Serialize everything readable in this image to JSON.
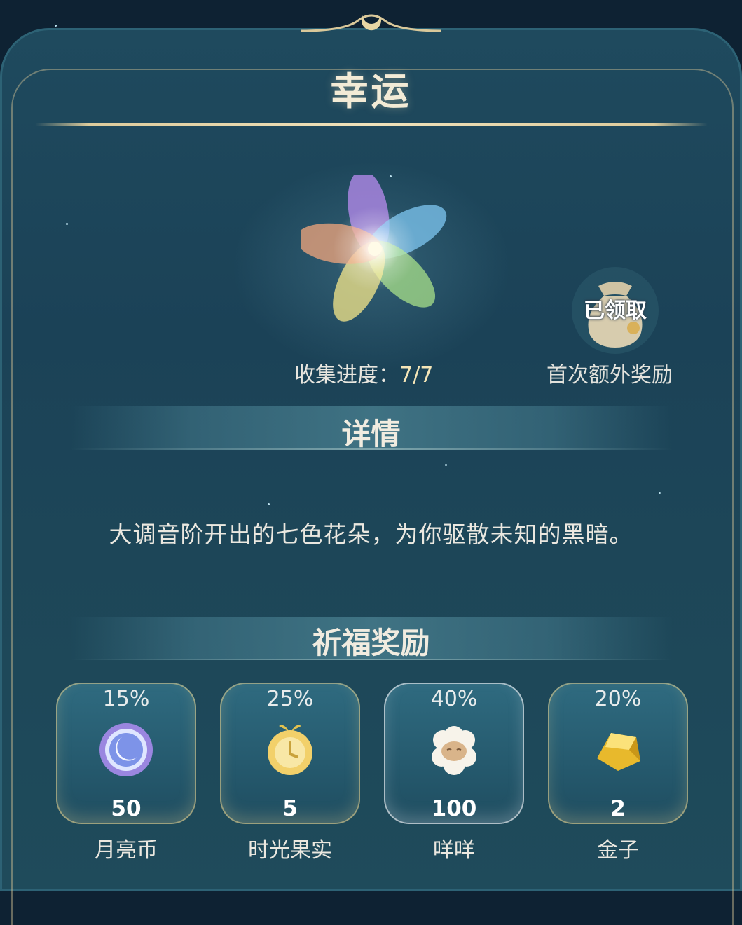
{
  "title": "幸运",
  "collection": {
    "label": "收集进度：",
    "value": "7/7"
  },
  "bonus": {
    "status": "已领取",
    "label": "首次额外奖励"
  },
  "details": {
    "heading": "详情",
    "text": "大调音阶开出的七色花朵，为你驱散未知的黑暗。"
  },
  "rewards": {
    "heading": "祈福奖励",
    "items": [
      {
        "percent": "15%",
        "amount": "50",
        "name": "月亮币",
        "icon": "moon-coin-icon"
      },
      {
        "percent": "25%",
        "amount": "5",
        "name": "时光果实",
        "icon": "time-fruit-icon"
      },
      {
        "percent": "40%",
        "amount": "100",
        "name": "咩咩",
        "icon": "sheep-icon"
      },
      {
        "percent": "20%",
        "amount": "2",
        "name": "金子",
        "icon": "gold-icon"
      }
    ]
  },
  "colors": {
    "panel": "#1f4a5e",
    "gold_trim": "#ddcb9c",
    "text": "#ebe8e0"
  }
}
